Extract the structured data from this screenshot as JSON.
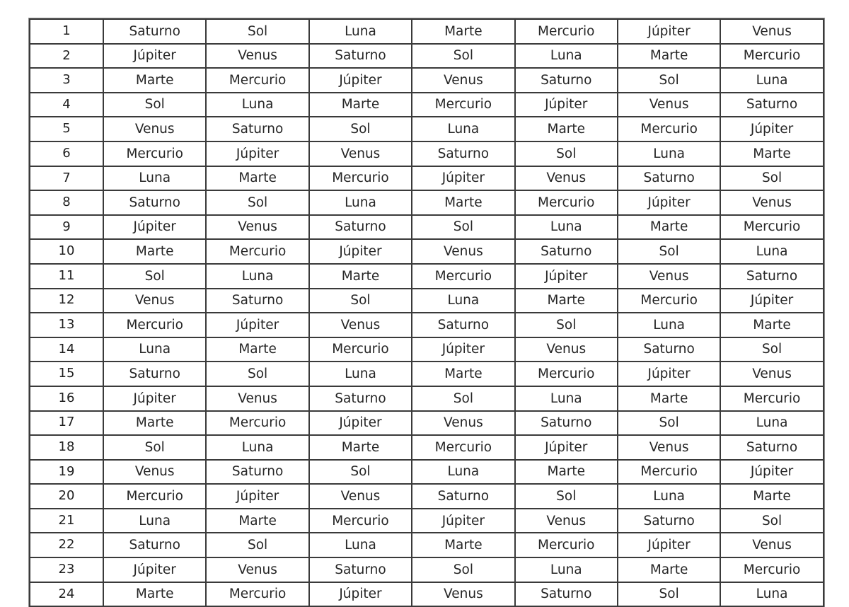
{
  "document": {
    "kind": "planetary-hours-table",
    "columns": 8,
    "rows": 24,
    "column_headers_visible": false,
    "index_column_label": "",
    "ink_color": "#262626",
    "grid_color": "#3a3a3a",
    "page_background": "#ffffff"
  },
  "planet_names": [
    "Saturno",
    "Sol",
    "Luna",
    "Marte",
    "Mercurio",
    "Júpiter",
    "Venus"
  ],
  "table": {
    "rows": [
      {
        "index": "1",
        "cells": [
          "Saturno",
          "Sol",
          "Luna",
          "Marte",
          "Mercurio",
          "Júpiter",
          "Venus"
        ]
      },
      {
        "index": "2",
        "cells": [
          "Júpiter",
          "Venus",
          "Saturno",
          "Sol",
          "Luna",
          "Marte",
          "Mercurio"
        ]
      },
      {
        "index": "3",
        "cells": [
          "Marte",
          "Mercurio",
          "Júpiter",
          "Venus",
          "Saturno",
          "Sol",
          "Luna"
        ]
      },
      {
        "index": "4",
        "cells": [
          "Sol",
          "Luna",
          "Marte",
          "Mercurio",
          "Júpiter",
          "Venus",
          "Saturno"
        ]
      },
      {
        "index": "5",
        "cells": [
          "Venus",
          "Saturno",
          "Sol",
          "Luna",
          "Marte",
          "Mercurio",
          "Júpiter"
        ]
      },
      {
        "index": "6",
        "cells": [
          "Mercurio",
          "Júpiter",
          "Venus",
          "Saturno",
          "Sol",
          "Luna",
          "Marte"
        ]
      },
      {
        "index": "7",
        "cells": [
          "Luna",
          "Marte",
          "Mercurio",
          "Júpiter",
          "Venus",
          "Saturno",
          "Sol"
        ]
      },
      {
        "index": "8",
        "cells": [
          "Saturno",
          "Sol",
          "Luna",
          "Marte",
          "Mercurio",
          "Júpiter",
          "Venus"
        ]
      },
      {
        "index": "9",
        "cells": [
          "Júpiter",
          "Venus",
          "Saturno",
          "Sol",
          "Luna",
          "Marte",
          "Mercurio"
        ]
      },
      {
        "index": "10",
        "cells": [
          "Marte",
          "Mercurio",
          "Júpiter",
          "Venus",
          "Saturno",
          "Sol",
          "Luna"
        ]
      },
      {
        "index": "11",
        "cells": [
          "Sol",
          "Luna",
          "Marte",
          "Mercurio",
          "Júpiter",
          "Venus",
          "Saturno"
        ]
      },
      {
        "index": "12",
        "cells": [
          "Venus",
          "Saturno",
          "Sol",
          "Luna",
          "Marte",
          "Mercurio",
          "Júpiter"
        ]
      },
      {
        "index": "13",
        "cells": [
          "Mercurio",
          "Júpiter",
          "Venus",
          "Saturno",
          "Sol",
          "Luna",
          "Marte"
        ]
      },
      {
        "index": "14",
        "cells": [
          "Luna",
          "Marte",
          "Mercurio",
          "Júpiter",
          "Venus",
          "Saturno",
          "Sol"
        ]
      },
      {
        "index": "15",
        "cells": [
          "Saturno",
          "Sol",
          "Luna",
          "Marte",
          "Mercurio",
          "Júpiter",
          "Venus"
        ]
      },
      {
        "index": "16",
        "cells": [
          "Júpiter",
          "Venus",
          "Saturno",
          "Sol",
          "Luna",
          "Marte",
          "Mercurio"
        ]
      },
      {
        "index": "17",
        "cells": [
          "Marte",
          "Mercurio",
          "Júpiter",
          "Venus",
          "Saturno",
          "Sol",
          "Luna"
        ]
      },
      {
        "index": "18",
        "cells": [
          "Sol",
          "Luna",
          "Marte",
          "Mercurio",
          "Júpiter",
          "Venus",
          "Saturno"
        ]
      },
      {
        "index": "19",
        "cells": [
          "Venus",
          "Saturno",
          "Sol",
          "Luna",
          "Marte",
          "Mercurio",
          "Júpiter"
        ]
      },
      {
        "index": "20",
        "cells": [
          "Mercurio",
          "Júpiter",
          "Venus",
          "Saturno",
          "Sol",
          "Luna",
          "Marte"
        ]
      },
      {
        "index": "21",
        "cells": [
          "Luna",
          "Marte",
          "Mercurio",
          "Júpiter",
          "Venus",
          "Saturno",
          "Sol"
        ]
      },
      {
        "index": "22",
        "cells": [
          "Saturno",
          "Sol",
          "Luna",
          "Marte",
          "Mercurio",
          "Júpiter",
          "Venus"
        ]
      },
      {
        "index": "23",
        "cells": [
          "Júpiter",
          "Venus",
          "Saturno",
          "Sol",
          "Luna",
          "Marte",
          "Mercurio"
        ]
      },
      {
        "index": "24",
        "cells": [
          "Marte",
          "Mercurio",
          "Júpiter",
          "Venus",
          "Saturno",
          "Sol",
          "Luna"
        ]
      }
    ]
  }
}
